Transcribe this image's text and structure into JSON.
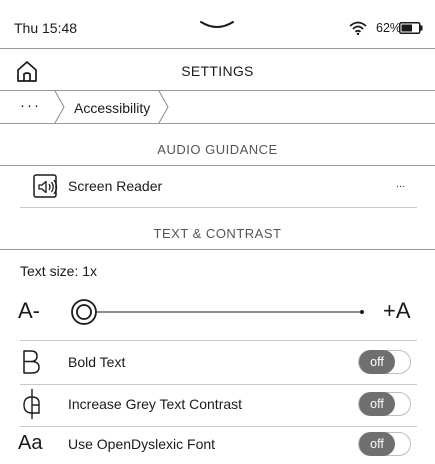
{
  "status_bar": {
    "time": "Thu 15:48",
    "battery": "62%"
  },
  "header": {
    "title": "SETTINGS",
    "home_icon": "home-icon"
  },
  "breadcrumb": {
    "more": "···",
    "current": "Accessibility"
  },
  "sections": {
    "audio_guidance": "AUDIO GUIDANCE",
    "text_contrast": "TEXT & CONTRAST"
  },
  "screen_reader": {
    "label": "Screen Reader",
    "more": "...",
    "icon": "screen-reader-icon"
  },
  "text_size": {
    "label": "Text size: 1x",
    "minus": "A-",
    "plus": "+A",
    "level": 0
  },
  "toggles": [
    {
      "label": "Bold Text",
      "state": "off",
      "icon": "bold-text-icon"
    },
    {
      "label": "Increase Grey Text Contrast",
      "state": "off",
      "icon": "contrast-icon"
    },
    {
      "label": "Use OpenDyslexic Font",
      "state": "off",
      "icon": "font-icon",
      "icon_text": "Aa"
    }
  ],
  "colors": {
    "toggle_off": "#6f6f6f",
    "divider": "#9a9a9a",
    "section_text": "#555555"
  }
}
